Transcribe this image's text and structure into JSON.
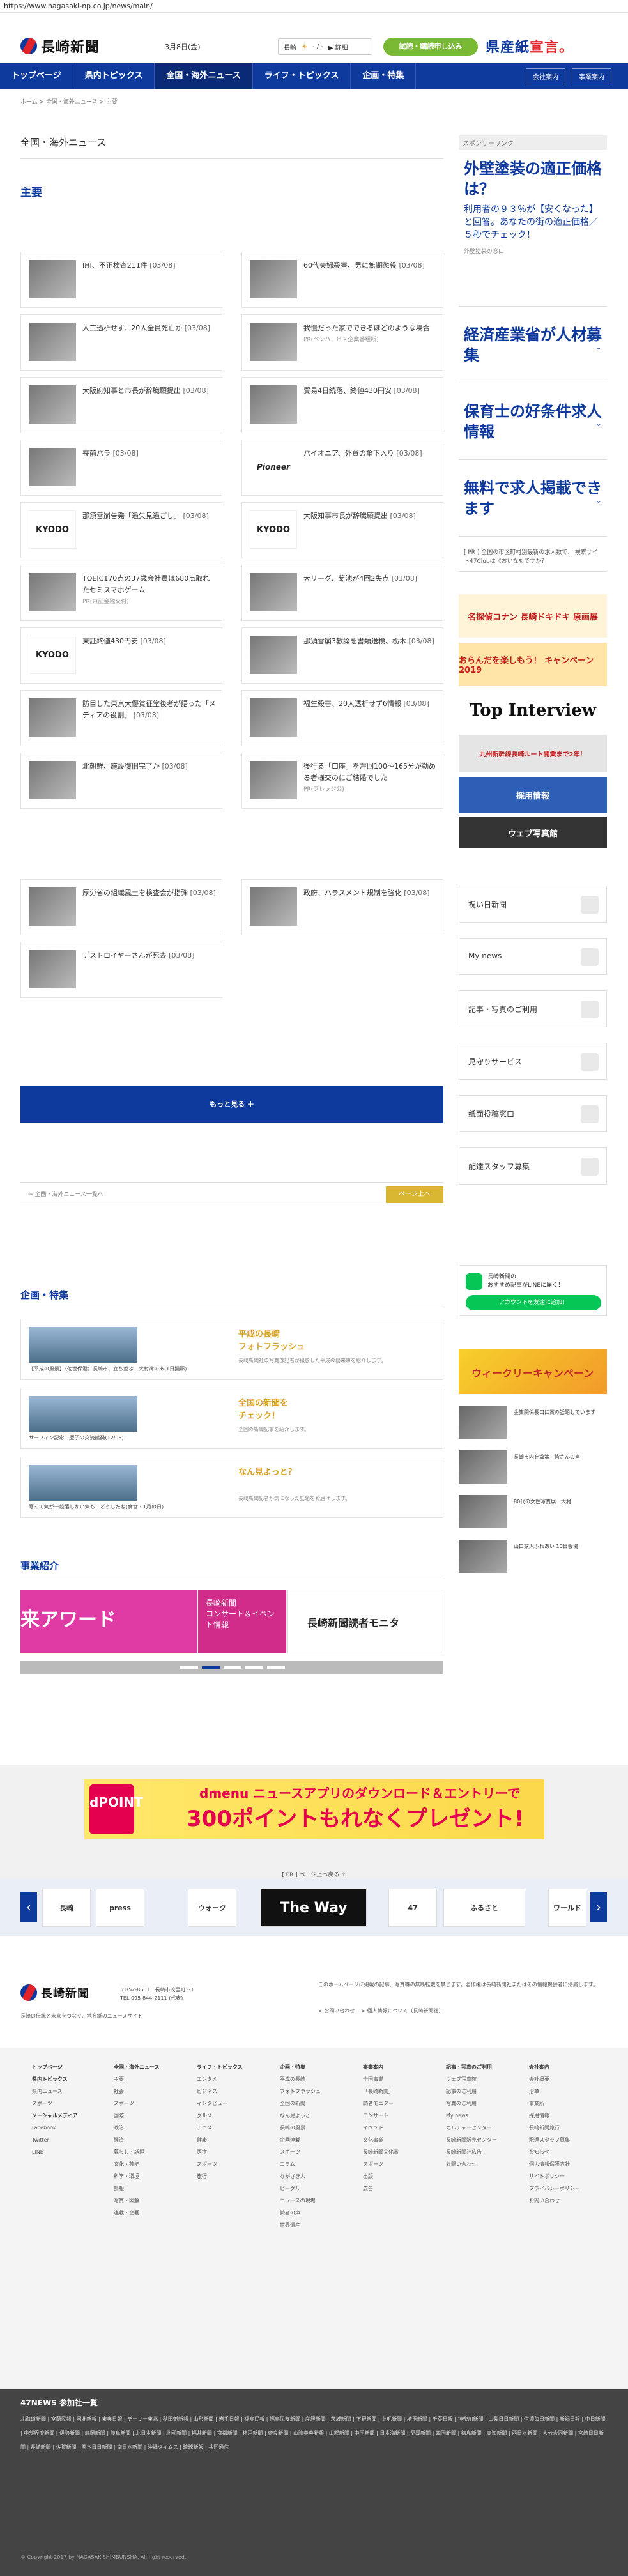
{
  "browser": {
    "url": "https://www.nagasaki-np.co.jp/news/main/"
  },
  "header": {
    "logo_text": "長崎新聞",
    "date": "3月8日(金)",
    "weather_label": "長崎",
    "weather_temp": "- / -",
    "weather_link": "▶ 詳細",
    "trial_button": "試読・購読申し込み",
    "kenkan_a": "県産紙",
    "kenkan_b": "宣言。"
  },
  "nav": {
    "items": [
      "トップページ",
      "県内トピックス",
      "全国・海外ニュース",
      "ライフ・トピックス",
      "企画・特集"
    ],
    "right": [
      "会社案内",
      "事業案内"
    ]
  },
  "breadcrumb": "ホーム > 全国・海外ニュース > 主要",
  "section_title": "全国・海外ニュース",
  "sub_title": "主要",
  "news": [
    {
      "title": "IHI、不正検査211件",
      "date": "[03/08]",
      "pr": ""
    },
    {
      "title": "60代夫婦殺害、男に無期懲役",
      "date": "[03/08]",
      "pr": ""
    },
    {
      "title": "人工透析せず、20人全員死亡か",
      "date": "[03/08]",
      "pr": ""
    },
    {
      "title": "我慢だった家でできるほどのような場合",
      "date": "",
      "pr": "PR(ベンハービス企業番組所)"
    },
    {
      "title": "大阪府知事と市長が辞職願提出",
      "date": "[03/08]",
      "pr": ""
    },
    {
      "title": "貿易4日続落、終値430円安",
      "date": "[03/08]",
      "pr": ""
    },
    {
      "title": "喪前パラ",
      "date": "[03/08]",
      "pr": ""
    },
    {
      "title": "パイオニア、外資の傘下入り",
      "date": "[03/08]",
      "pr": ""
    },
    {
      "title": "那須雪崩告発「過失見過ごし」",
      "date": "[03/08]",
      "pr": ""
    },
    {
      "title": "大阪知事市長が辞職願提出",
      "date": "[03/08]",
      "pr": ""
    },
    {
      "title": "TOEIC170点の37歳会社員は680点取れたセミスマホゲーム",
      "date": "",
      "pr": "PR(東証金融交付)"
    },
    {
      "title": "大リーグ、菊池が4回2失点",
      "date": "[03/08]",
      "pr": ""
    },
    {
      "title": "東証終値430円安",
      "date": "[03/08]",
      "pr": ""
    },
    {
      "title": "那須雪崩3教論を書類送検、栃木",
      "date": "[03/08]",
      "pr": ""
    },
    {
      "title": "防目した東京大優賞征堂後者が語った「メディアの役割」",
      "date": "[03/08]",
      "pr": ""
    },
    {
      "title": "福生殺害、20人透析せず6情報",
      "date": "[03/08]",
      "pr": ""
    },
    {
      "title": "北朝鮮、施設復旧完了か",
      "date": "[03/08]",
      "pr": ""
    },
    {
      "title": "後行る「口座」を左回100～165分が勤める者様交のにご結婚でした",
      "date": "",
      "pr": "PR(ブレッジ公)"
    },
    {
      "title": "厚労省の組織風土を検査会が指弾",
      "date": "[03/08]",
      "pr": ""
    },
    {
      "title": "政府、ハラスメント規制を強化",
      "date": "[03/08]",
      "pr": ""
    },
    {
      "title": "デストロイヤーさんが死去",
      "date": "[03/08]",
      "pr": ""
    }
  ],
  "more_button": "もっと見る ＋",
  "pager": {
    "prev": "← 全国・海外ニュース一覧へ",
    "next": "ページ上へ"
  },
  "kikaku": {
    "heading": "企画・特集",
    "items": [
      {
        "caption": "【平成の風景】（佐世保港）長崎市、立ち並ぶ…大村湾のあ(1日撮影)",
        "title": "平成の長崎\nフォトフラッシュ",
        "desc": "長崎新聞社の写真部記者が撮影した平成の出来事を紹介します。"
      },
      {
        "caption": "サーフィン記念　慶子の交流館発(12/05)",
        "title": "全国の新聞を\nチェック！",
        "desc": "全国の新聞記事を紹介します。"
      },
      {
        "caption": "寒くて気が一段落しかい気も…どうしたね(食宮・1月の日)",
        "title": "なん見よっと？",
        "desc": "長崎新聞記者が気になった話題をお届けします。"
      }
    ]
  },
  "jigyo": {
    "heading": "事業紹介",
    "banner_a": "来アワード",
    "banner_b": "長崎新聞\nコンサート＆イベント情報",
    "banner_c": "長崎新聞読者モニタ"
  },
  "dmenu": {
    "logo": "dPOINT",
    "line1": "dmenu ニュースアプリのダウンロード＆エントリーで",
    "line2": "300ポイントもれなくプレゼント!"
  },
  "pr_link": "[ PR ] ページ上へ戻る ↑",
  "carousel": [
    "長崎",
    "press",
    "ウォーク",
    "The Way",
    "47",
    "ふるさと",
    "ワールド"
  ],
  "footer": {
    "logo_text": "長崎新聞",
    "address": "〒852-8601　長崎市茂里町3-1",
    "tel": "TEL 095-844-2111 (代表)",
    "slogan": "長崎の伝統と未来をつなぐ、地方紙のニュースサイト",
    "notice": "このホームページに掲載の記事、写真等の無断転載を禁じます。著作権は長崎新聞社またはその情報提供者に帰属します。",
    "links": [
      "> お問い合わせ",
      "> 個人情報について（長崎新聞社）"
    ],
    "sitemap": [
      {
        "head": "トップページ",
        "items": [
          "",
          "県内トピックス",
          "県内ニュース",
          "スポーツ",
          "",
          "ソーシャルメディア",
          "Facebook",
          "Twitter",
          "LINE"
        ]
      },
      {
        "head": "全国・海外ニュース",
        "items": [
          "主要",
          "社会",
          "スポーツ",
          "国際",
          "政治",
          "経済",
          "暮らし・話題",
          "文化・芸能",
          "科学・環境",
          "訃報",
          "写真・図解",
          "連載・企画"
        ]
      },
      {
        "head": "ライフ・トピックス",
        "items": [
          "エンタメ",
          "ビジネス",
          "インタビュー",
          "グルメ",
          "アニメ",
          "健康",
          "医療",
          "スポーツ",
          "旅行"
        ]
      },
      {
        "head": "企画・特集",
        "items": [
          "平成の長崎",
          "フォトフラッシュ",
          "全国の新聞",
          "なん見よっと",
          "長崎の風景",
          "企画連載",
          "スポーツ",
          "コラム",
          "ながさき人",
          "ビーグル",
          "ニュースの現場",
          "読者の声",
          "世界遺産"
        ]
      },
      {
        "head": "事業案内",
        "items": [
          "全国事業",
          "「長崎新聞」",
          "読者モニター",
          "コンサート",
          "イベント",
          "文化事業",
          "長崎新聞文化賞",
          "スポーツ",
          "出版",
          "広告"
        ]
      },
      {
        "head": "記事・写真のご利用",
        "items": [
          "ウェブ写真館",
          "記事のご利用",
          "写真のご利用",
          "My news",
          "カルチャーセンター",
          "長崎新聞販売センター",
          "長崎新聞社広告",
          "お問い合わせ"
        ]
      },
      {
        "head": "会社案内",
        "items": [
          "会社概要",
          "沿革",
          "事業所",
          "採用情報",
          "長崎新聞旅行",
          "配達スタッフ募集",
          "お知らせ",
          "個人情報保護方針",
          "サイトポリシー",
          "プライバシーポリシー",
          "お問い合わせ"
        ]
      }
    ],
    "dark_head": "47NEWS 参加社一覧",
    "members": "北海道新聞 | 室蘭民報 | 河北新報 | 東奥日報 | デーリー東北 | 秋田魁新報 | 山形新聞 | 岩手日報 | 福島民報 | 福島民友新聞 | 産経新聞 | 茨城新聞 | 下野新聞 | 上毛新聞 | 埼玉新聞 | 千葉日報 | 神奈川新聞 | 山梨日日新聞 | 信濃毎日新聞 | 新潟日報 | 中日新聞 | 中部経済新聞 | 伊勢新聞 | 静岡新聞 | 岐阜新聞 | 北日本新聞 | 北國新聞 | 福井新聞 | 京都新聞 | 神戸新聞 | 奈良新聞 | 山陰中央新報 | 山陽新聞 | 中国新聞 | 日本海新聞 | 愛媛新聞 | 四国新聞 | 徳島新聞 | 高知新聞 | 西日本新聞 | 大分合同新聞 | 宮崎日日新聞 | 長崎新聞 | 佐賀新聞 | 熊本日日新聞 | 南日本新聞 | 沖縄タイムス | 琉球新報 | 共同通信",
    "copyright": "© Copyright 2017 by NAGASAKISHIMBUNSHA. All right reserved."
  },
  "sidebar": {
    "sponsored_label": "スポンサーリンク",
    "ad1": {
      "big": "外壁塗装の適正価格は？",
      "desc": "利用者の９３％が【安くなった】と回答。あなたの街の適正価格／５秒でチェック！",
      "src": "外壁塗装の窓口"
    },
    "ad2": {
      "big": "経済産業省が人材募集"
    },
    "ad3": {
      "big": "保育士の好条件求人情報"
    },
    "ad4": {
      "big": "無料で求人掲載できます"
    },
    "ad_small": "[ PR ] 全国の市区町村別最新の求人数で、 検索サイト47Clubは《おいなもですか？",
    "banners": [
      "名探偵コナン 長崎ドキドキ 原画展",
      "おらんだを楽しもう！ キャンペーン 2019",
      "Top Interview",
      "九州新幹線長崎ルート開業まで2年！",
      "採用情報",
      "ウェブ写真館"
    ],
    "buttons": [
      "祝い日新聞",
      "My news",
      "記事・写真のご利用",
      "見守りサービス",
      "紙面投稿窓口",
      "配達スタッフ募集"
    ],
    "line": {
      "text": "長崎新聞の\nおすすめ記事がLINEに届く！",
      "button": "アカウントを友達に追加！"
    },
    "weekly": "ウィークリーキャンペーン",
    "side_news": [
      {
        "text": "金業関係長口に賞の話題しています"
      },
      {
        "text": "長崎市内を散策　皆さんの声"
      },
      {
        "text": "80代の女性写真展　大村"
      },
      {
        "text": "山口家入ふれあい 10日会場"
      }
    ]
  }
}
